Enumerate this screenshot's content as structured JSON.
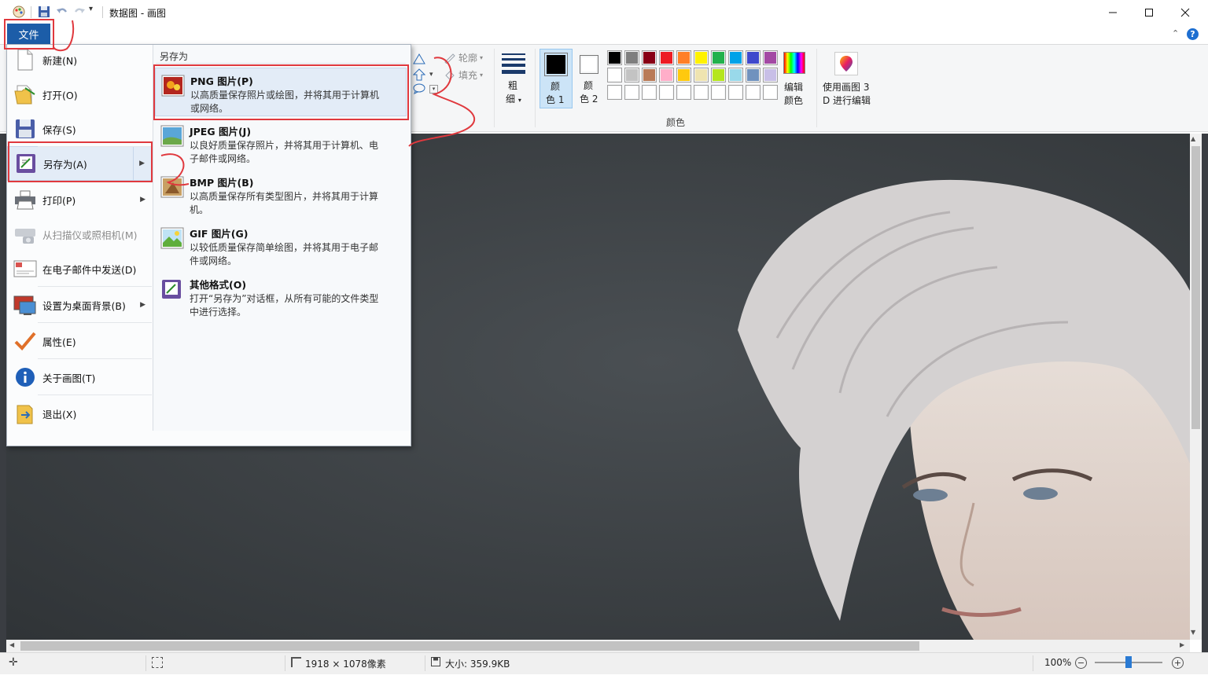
{
  "window": {
    "title": "数据图 - 画图",
    "controls": [
      "minimize",
      "maximize",
      "close"
    ]
  },
  "ribbon": {
    "file_tab": "文件",
    "shapes": {
      "outline_label": "轮廓",
      "fill_label": "填充"
    },
    "size": {
      "label_line1": "粗",
      "label_line2": "细"
    },
    "color1": {
      "label_line1": "颜",
      "label_line2": "色 1",
      "value": "#000000"
    },
    "color2": {
      "label_line1": "颜",
      "label_line2": "色 2",
      "value": "#ffffff"
    },
    "palette_row1": [
      "#000000",
      "#7f7f7f",
      "#880015",
      "#ed1c24",
      "#ff7f27",
      "#fff200",
      "#22b14c",
      "#00a2e8",
      "#3f48cc",
      "#a349a4"
    ],
    "palette_row2": [
      "#ffffff",
      "#c3c3c3",
      "#b97a57",
      "#ffaec9",
      "#ffc90e",
      "#efe4b0",
      "#b5e61d",
      "#99d9ea",
      "#7092be",
      "#c8bfe7"
    ],
    "palette_row3": [
      "#ffffff",
      "#ffffff",
      "#ffffff",
      "#ffffff",
      "#ffffff",
      "#ffffff",
      "#ffffff",
      "#ffffff",
      "#ffffff",
      "#ffffff"
    ],
    "edit_colors": {
      "line1": "编辑",
      "line2": "颜色"
    },
    "paint3d": {
      "line1": "使用画图 3",
      "line2": "D 进行编辑"
    },
    "colors_group_label": "颜色"
  },
  "file_menu": {
    "items": [
      {
        "name": "new",
        "label": "新建(N)"
      },
      {
        "name": "open",
        "label": "打开(O)"
      },
      {
        "name": "save",
        "label": "保存(S)"
      },
      {
        "name": "save-as",
        "label": "另存为(A)"
      },
      {
        "name": "print",
        "label": "打印(P)"
      },
      {
        "name": "scan",
        "label": "从扫描仪或照相机(M)"
      },
      {
        "name": "email",
        "label": "在电子邮件中发送(D)"
      },
      {
        "name": "wallpaper",
        "label": "设置为桌面背景(B)"
      },
      {
        "name": "properties",
        "label": "属性(E)"
      },
      {
        "name": "about",
        "label": "关于画图(T)"
      },
      {
        "name": "exit",
        "label": "退出(X)"
      }
    ],
    "save_as_panel": {
      "header": "另存为",
      "options": [
        {
          "title": "PNG 图片(P)",
          "desc": "以高质量保存照片或绘图，并将其用于计算机或网络。"
        },
        {
          "title": "JPEG 图片(J)",
          "desc": "以良好质量保存照片，并将其用于计算机、电子邮件或网络。"
        },
        {
          "title": "BMP 图片(B)",
          "desc": "以高质量保存所有类型图片，并将其用于计算机。"
        },
        {
          "title": "GIF 图片(G)",
          "desc": "以较低质量保存简单绘图，并将其用于电子邮件或网络。"
        },
        {
          "title": "其他格式(O)",
          "desc": "打开“另存为”对话框，从所有可能的文件类型中进行选择。"
        }
      ]
    }
  },
  "statusbar": {
    "dimensions": "1918 × 1078像素",
    "size": "大小: 359.9KB",
    "zoom": "100%",
    "zoom_fraction": 0.5
  }
}
